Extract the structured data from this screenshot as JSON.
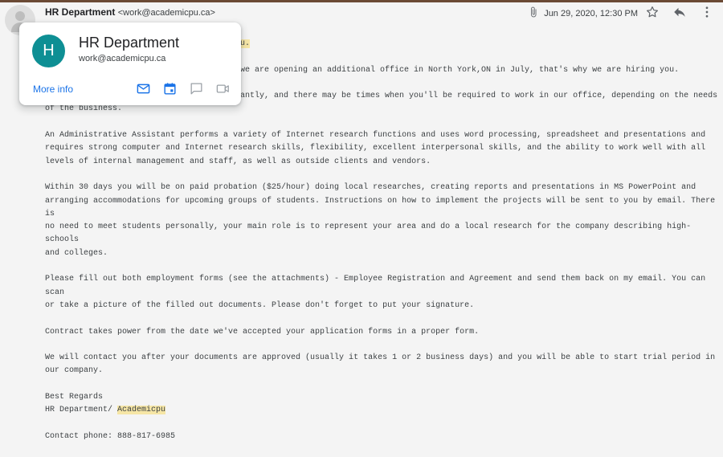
{
  "email": {
    "sender_name": "HR Department",
    "sender_address": "<work@academicpu.ca>",
    "date": "Jun 29, 2020, 12:30 PM"
  },
  "icons": {
    "attachment": "paperclip-icon",
    "star": "star-icon",
    "reply": "reply-icon",
    "more": "more-vert-icon"
  },
  "contact_card": {
    "initial": "H",
    "name": "HR Department",
    "email": "work@academicpu.ca",
    "more_info": "More info",
    "avatar_color": "#0e8f94",
    "icons": [
      "mail-icon",
      "calendar-icon",
      "chat-icon",
      "video-icon"
    ]
  },
  "body": {
    "peek_highlight": "u.",
    "peek_line2": "we are opening an additional office in North York,ON in July, that's why we are hiring you.",
    "p1_start": "antly, and there may be times when you'll be required to work in our office, depending on the needs",
    "p1_end": "of the business.",
    "p2": "An Administrative Assistant performs a variety of Internet research functions and uses word processing, spreadsheet and presentations and\nrequires strong computer and Internet research skills, flexibility, excellent interpersonal skills, and the ability to work well with all\nlevels of internal management and staff, as well as outside clients and vendors.",
    "p3": "Within 30 days you will be on paid probation ($25/hour) doing local researches, creating reports and presentations in MS PowerPoint and\narranging accommodations for upcoming groups of students. Instructions on how to implement the projects will be sent to you by email. There is\nno need to meet students personally, your main role is to represent your area and do a local research for the company describing high-schools\nand colleges.",
    "p4": "Please fill out both employment forms (see the attachments) - Employee Registration and Agreement and send them back on my email. You can scan\nor take a picture of the filled out documents. Please don't forget to put your signature.",
    "p5": "Contract takes power from the date we've accepted your application forms in a proper form.",
    "p6": "We will contact you after your documents are approved (usually it takes 1 or 2 business days) and you will be able to start trial period in\nour company.",
    "closing": "Best Regards",
    "signature_prefix": "HR Department/ ",
    "signature_highlight": "Academicpu",
    "contact": "Contact phone: 888-817-6985"
  },
  "colors": {
    "accent_link": "#1a73e8",
    "highlight": "#f6e6a6",
    "top_strip": "#6b4a35"
  }
}
